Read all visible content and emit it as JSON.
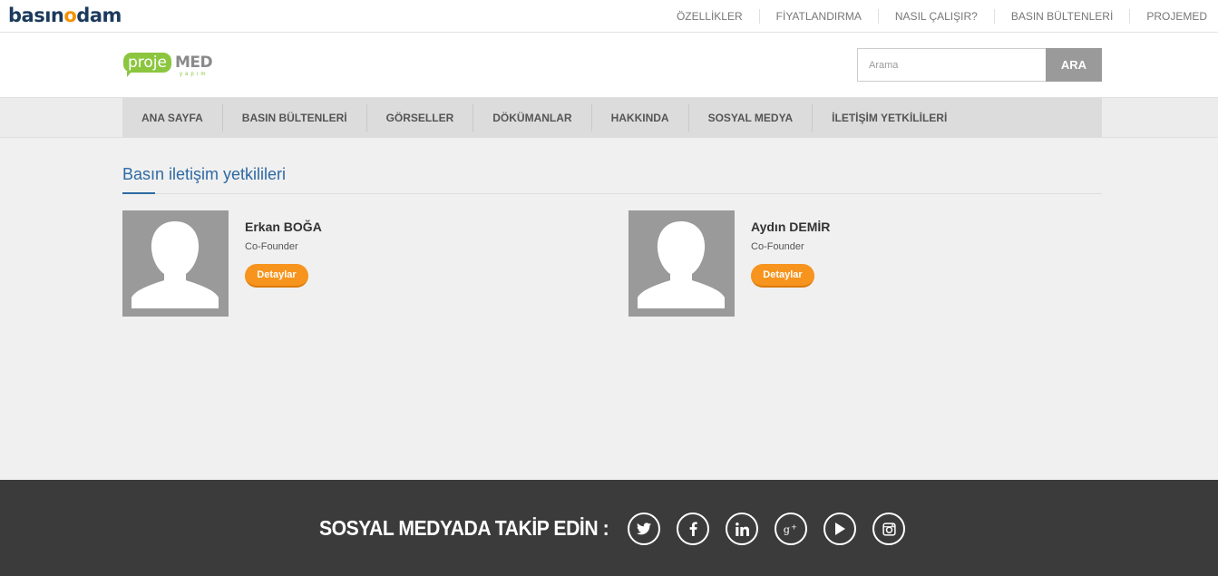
{
  "topbar": {
    "brand_a": "basın",
    "brand_o": "o",
    "brand_b": "dam",
    "links": [
      "ÖZELLİKLER",
      "FİYATLANDIRMA",
      "NASIL ÇALIŞIR?",
      "BASIN BÜLTENLERİ",
      "PROJEMED"
    ]
  },
  "header": {
    "logo_main": "proje",
    "logo_accent": "MED",
    "logo_sub": "yapım",
    "search_placeholder": "Arama",
    "search_button": "ARA"
  },
  "nav": {
    "items": [
      "ANA SAYFA",
      "BASIN BÜLTENLERİ",
      "GÖRSELLER",
      "DÖKÜMANLAR",
      "HAKKINDA",
      "SOSYAL MEDYA",
      "İLETİŞİM YETKİLİLERİ"
    ]
  },
  "content": {
    "title": "Basın iletişim yetkilileri",
    "contacts": [
      {
        "name": "Erkan BOĞA",
        "role": "Co-Founder",
        "button": "Detaylar"
      },
      {
        "name": "Aydın DEMİR",
        "role": "Co-Founder",
        "button": "Detaylar"
      }
    ]
  },
  "footer": {
    "follow_label": "SOSYAL MEDYADA TAKİP EDİN :",
    "social_icons": [
      "twitter-icon",
      "facebook-icon",
      "linkedin-icon",
      "google-plus-icon",
      "youtube-icon",
      "instagram-icon"
    ]
  }
}
